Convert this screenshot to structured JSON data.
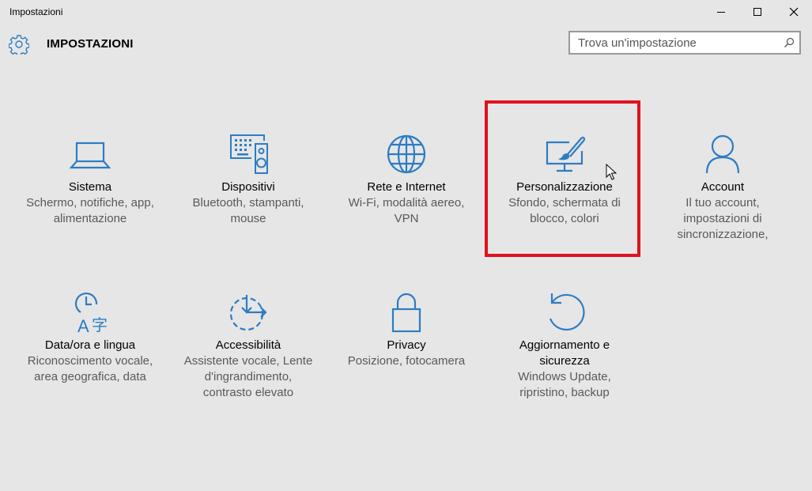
{
  "window": {
    "title": "Impostazioni",
    "controls": [
      "minimize",
      "maximize",
      "close"
    ]
  },
  "header": {
    "title": "IMPOSTAZIONI",
    "icon": "gear-icon"
  },
  "search": {
    "placeholder": "Trova un'impostazione",
    "value": "",
    "icon": "search-icon"
  },
  "tiles": [
    {
      "name": "Sistema",
      "desc": [
        "Schermo, notifiche, app,",
        "alimentazione"
      ],
      "icon": "laptop-icon"
    },
    {
      "name": "Dispositivi",
      "desc": [
        "Bluetooth, stampanti,",
        "mouse"
      ],
      "icon": "devices-icon"
    },
    {
      "name": "Rete e Internet",
      "desc": [
        "Wi-Fi, modalità aereo,",
        "VPN"
      ],
      "icon": "globe-icon"
    },
    {
      "name": "Personalizzazione",
      "desc": [
        "Sfondo, schermata di",
        "blocco, colori"
      ],
      "icon": "paintbrush-monitor-icon"
    },
    {
      "name": "Account",
      "desc": [
        "Il tuo account,",
        "impostazioni di",
        "sincronizzazione,"
      ],
      "icon": "person-icon"
    },
    {
      "name": "Data/ora e lingua",
      "desc": [
        "Riconoscimento vocale,",
        "area geografica, data"
      ],
      "icon": "time-language-icon"
    },
    {
      "name": "Accessibilità",
      "desc": [
        "Assistente vocale, Lente",
        "d'ingrandimento,",
        "contrasto elevato"
      ],
      "icon": "accessibility-icon"
    },
    {
      "name": "Privacy",
      "desc": [
        "Posizione, fotocamera"
      ],
      "icon": "lock-icon"
    },
    {
      "name": "Aggiornamento e sicurezza",
      "name_lines": [
        "Aggiornamento e",
        "sicurezza"
      ],
      "desc": [
        "Windows Update,",
        "ripristino, backup"
      ],
      "icon": "update-icon"
    }
  ],
  "colors": {
    "accent": "#2d7cc4",
    "background": "#e6e6e6",
    "highlight_box": "#e0111f",
    "desc_text": "#595959"
  }
}
